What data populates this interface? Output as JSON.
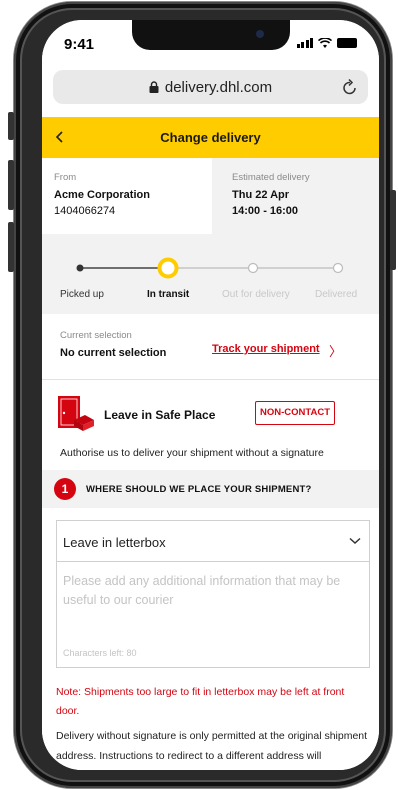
{
  "status_bar": {
    "time": "9:41"
  },
  "browser": {
    "url": "delivery.dhl.com"
  },
  "header": {
    "title": "Change delivery"
  },
  "shipment": {
    "from_label": "From",
    "from_name": "Acme Corporation",
    "from_number": "1404066274",
    "estimated_label": "Estimated delivery",
    "estimated_date": "Thu 22 Apr",
    "estimated_time": "14:00 - 16:00"
  },
  "progress": {
    "steps": [
      {
        "label": "Picked up",
        "state": "done"
      },
      {
        "label": "In transit",
        "state": "current"
      },
      {
        "label": "Out for delivery",
        "state": "pending"
      },
      {
        "label": "Delivered",
        "state": "pending"
      }
    ]
  },
  "current_selection": {
    "label": "Current selection",
    "value": "No current selection",
    "track_link": "Track your shipment"
  },
  "safe_place": {
    "title": "Leave in Safe Place",
    "badge": "NON-CONTACT",
    "description": "Authorise us to deliver your shipment without a signature"
  },
  "section": {
    "number": "1",
    "title": "WHERE SHOULD WE PLACE YOUR SHIPMENT?"
  },
  "form": {
    "selected_option": "Leave in letterbox",
    "textarea_placeholder": "Please add any additional information that may be useful to our courier",
    "characters_left": "Characters left: 80",
    "note": "Note: Shipments too large to fit in letterbox may be left at front door.",
    "delivery_text": "Delivery without signature is only permitted at the original shipment address. Instructions to redirect to a different address will"
  },
  "colors": {
    "brand_yellow": "#ffcc00",
    "brand_red": "#d40511"
  }
}
